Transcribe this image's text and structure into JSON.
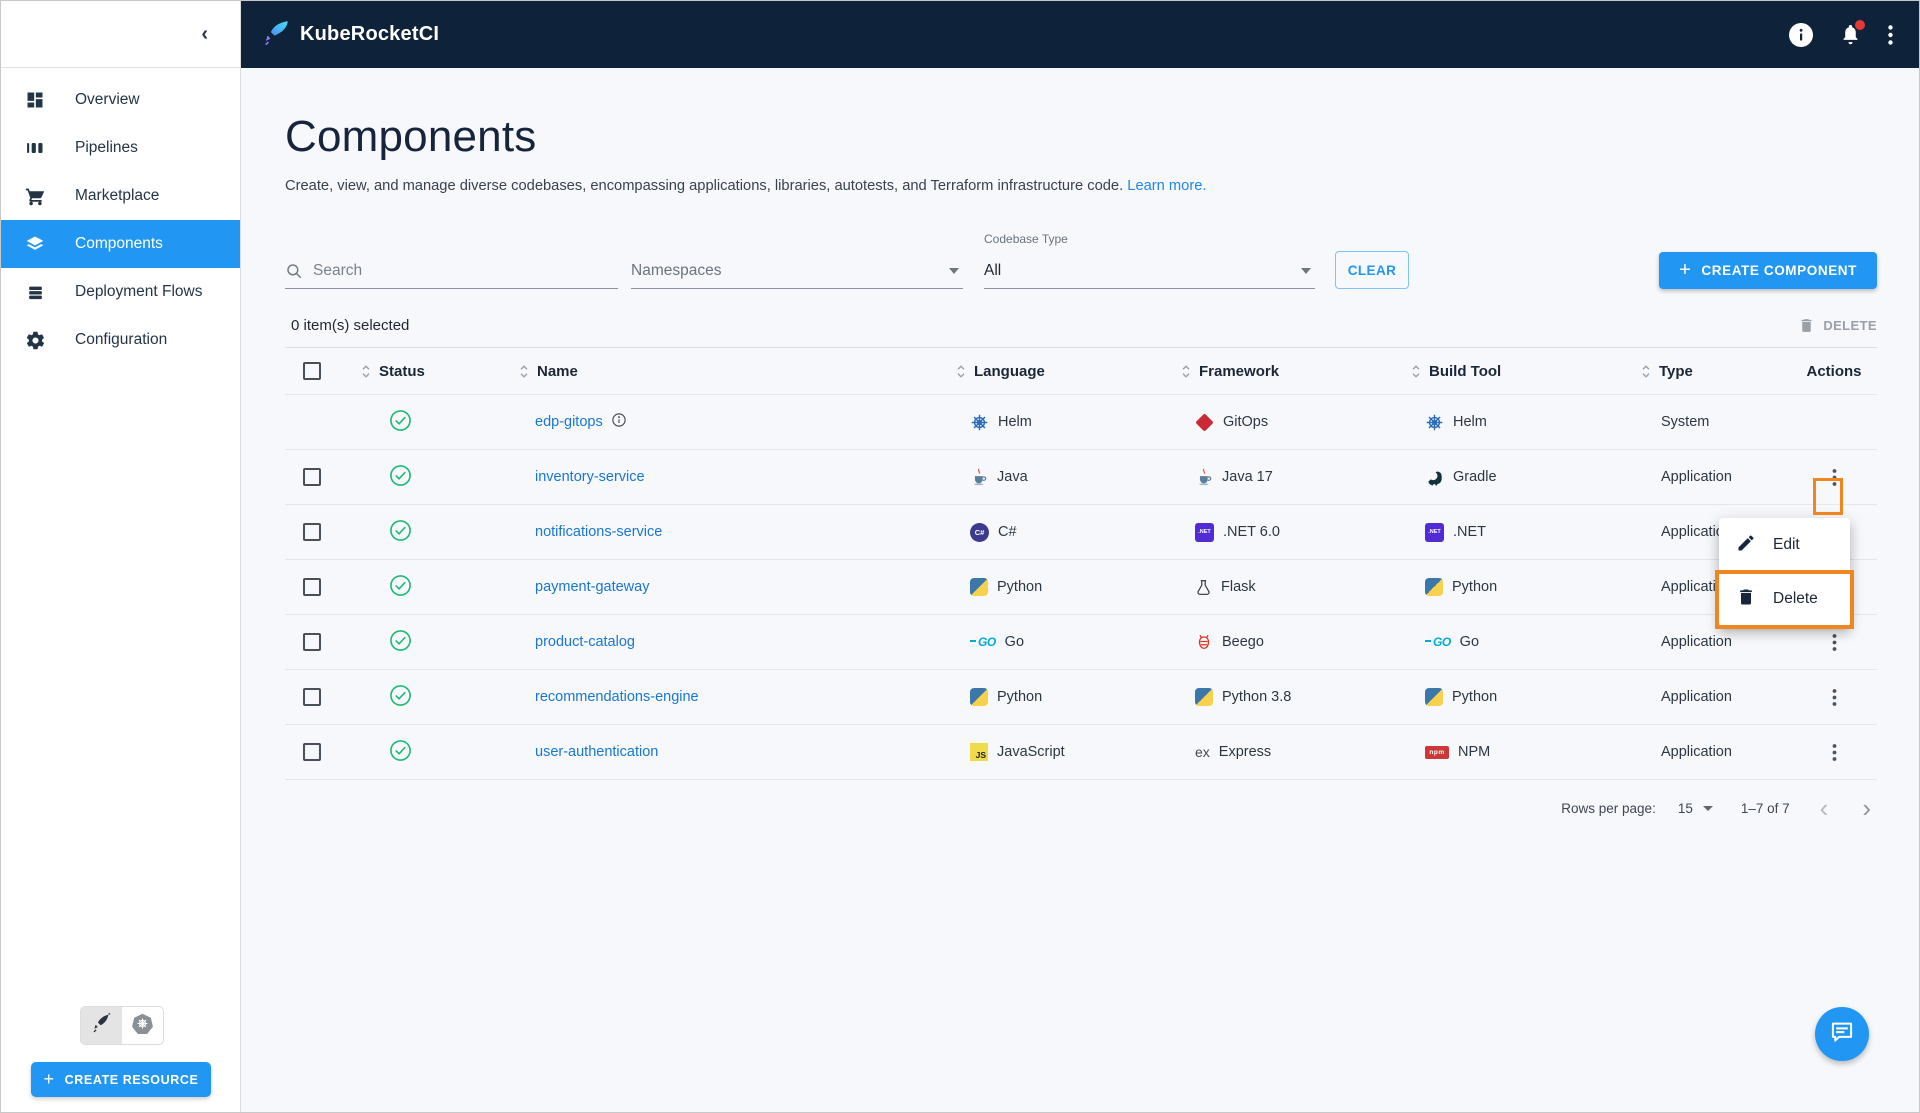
{
  "colors": {
    "accent": "#2196F3",
    "annotation_orange": "#F0861F",
    "header_bg": "#0E2339",
    "link_blue": "#1976D2",
    "status_green": "#1FB971"
  },
  "header": {
    "app_title": "KubeRocketCI"
  },
  "sidebar": {
    "items": [
      {
        "label": "Overview"
      },
      {
        "label": "Pipelines"
      },
      {
        "label": "Marketplace"
      },
      {
        "label": "Components",
        "selected": true
      },
      {
        "label": "Deployment Flows"
      },
      {
        "label": "Configuration"
      }
    ],
    "create_resource_label": "CREATE RESOURCE"
  },
  "page": {
    "title": "Components",
    "description": "Create, view, and manage diverse codebases, encompassing applications, libraries, autotests, and Terraform infrastructure code.",
    "learn_more": "Learn more."
  },
  "filters": {
    "search_placeholder": "Search",
    "namespaces_label": "Namespaces",
    "codebase_type_label": "Codebase Type",
    "codebase_type_value": "All",
    "clear_label": "CLEAR",
    "create_component_label": "CREATE COMPONENT"
  },
  "selection": {
    "text": "0 item(s) selected",
    "delete_label": "DELETE"
  },
  "table": {
    "columns": [
      "Status",
      "Name",
      "Language",
      "Framework",
      "Build Tool",
      "Type",
      "Actions"
    ],
    "rows": [
      {
        "name": "edp-gitops",
        "status": "ok",
        "has_info": true,
        "language": "Helm",
        "language_icon": "helm-icon",
        "framework": "GitOps",
        "framework_icon": "gitops-icon",
        "build_tool": "Helm",
        "build_tool_icon": "helm-icon",
        "type": "System",
        "has_checkbox": false,
        "has_actions": false
      },
      {
        "name": "inventory-service",
        "status": "ok",
        "language": "Java",
        "language_icon": "java-icon",
        "framework": "Java 17",
        "framework_icon": "java-icon",
        "build_tool": "Gradle",
        "build_tool_icon": "gradle-icon",
        "type": "Application",
        "has_checkbox": true,
        "has_actions": true,
        "actions_highlighted": true
      },
      {
        "name": "notifications-service",
        "status": "ok",
        "language": "C#",
        "language_icon": "csharp-icon",
        "framework": ".NET 6.0",
        "framework_icon": "dotnet-icon",
        "build_tool": ".NET",
        "build_tool_icon": "dotnet-icon",
        "type": "Application",
        "has_checkbox": true,
        "has_actions": true
      },
      {
        "name": "payment-gateway",
        "status": "ok",
        "language": "Python",
        "language_icon": "python-icon",
        "framework": "Flask",
        "framework_icon": "flask-icon",
        "build_tool": "Python",
        "build_tool_icon": "python-icon",
        "type": "Application",
        "has_checkbox": true,
        "has_actions": true
      },
      {
        "name": "product-catalog",
        "status": "ok",
        "language": "Go",
        "language_icon": "go-icon",
        "framework": "Beego",
        "framework_icon": "beego-icon",
        "build_tool": "Go",
        "build_tool_icon": "go-icon",
        "type": "Application",
        "has_checkbox": true,
        "has_actions": true
      },
      {
        "name": "recommendations-engine",
        "status": "ok",
        "language": "Python",
        "language_icon": "python-icon",
        "framework": "Python 3.8",
        "framework_icon": "python-icon",
        "build_tool": "Python",
        "build_tool_icon": "python-icon",
        "type": "Application",
        "has_checkbox": true,
        "has_actions": true
      },
      {
        "name": "user-authentication",
        "status": "ok",
        "language": "JavaScript",
        "language_icon": "javascript-icon",
        "framework": "Express",
        "framework_icon": "express-icon",
        "build_tool": "NPM",
        "build_tool_icon": "npm-icon",
        "type": "Application",
        "has_checkbox": true,
        "has_actions": true
      }
    ]
  },
  "pagination": {
    "rows_per_page_label": "Rows per page:",
    "rows_per_page_value": "15",
    "range": "1–7 of 7"
  },
  "context_menu": {
    "items": [
      {
        "label": "Edit"
      },
      {
        "label": "Delete"
      }
    ]
  },
  "glyphs": {
    "plus": "+",
    "collapse_chevron": "‹",
    "pagination_prev": "‹",
    "pagination_next": "›",
    "csharp": "C#",
    "dotnet": ".NET",
    "js": "JS",
    "npm": "npm",
    "go": "GO",
    "express": "ex"
  }
}
